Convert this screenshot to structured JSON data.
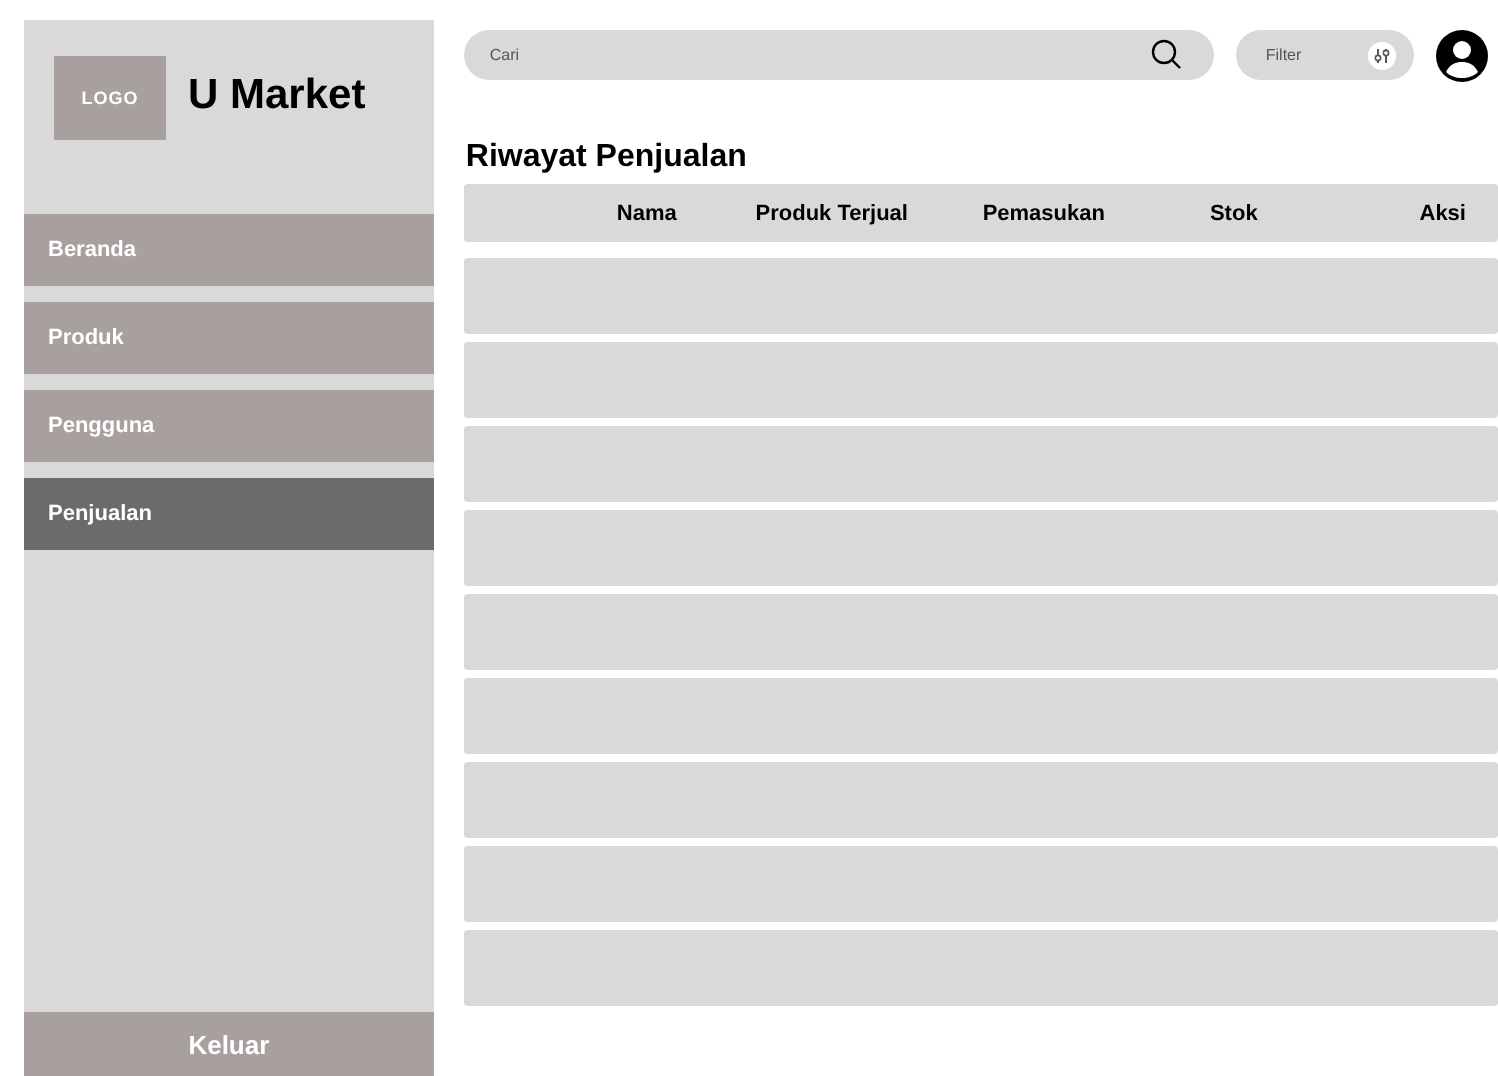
{
  "sidebar": {
    "logo": "LOGO",
    "brand": "U Market",
    "items": [
      {
        "label": "Beranda",
        "selected": false
      },
      {
        "label": "Produk",
        "selected": false
      },
      {
        "label": "Pengguna",
        "selected": false
      },
      {
        "label": "Penjualan",
        "selected": true
      }
    ],
    "logout": "Keluar"
  },
  "search": {
    "placeholder": "Cari"
  },
  "filter": {
    "label": "Filter"
  },
  "title": "Riwayat Penjualan",
  "table": {
    "columns": [
      "Nama",
      "Produk Terjual",
      "Pemasukan",
      "Stok",
      "Aksi"
    ],
    "rows": [
      {
        "kind": "empty"
      },
      {
        "kind": "empty"
      },
      {
        "kind": "empty"
      },
      {
        "kind": "empty"
      },
      {
        "kind": "empty"
      },
      {
        "kind": "empty"
      },
      {
        "kind": "empty"
      },
      {
        "kind": "empty"
      },
      {
        "kind": "empty"
      }
    ]
  }
}
